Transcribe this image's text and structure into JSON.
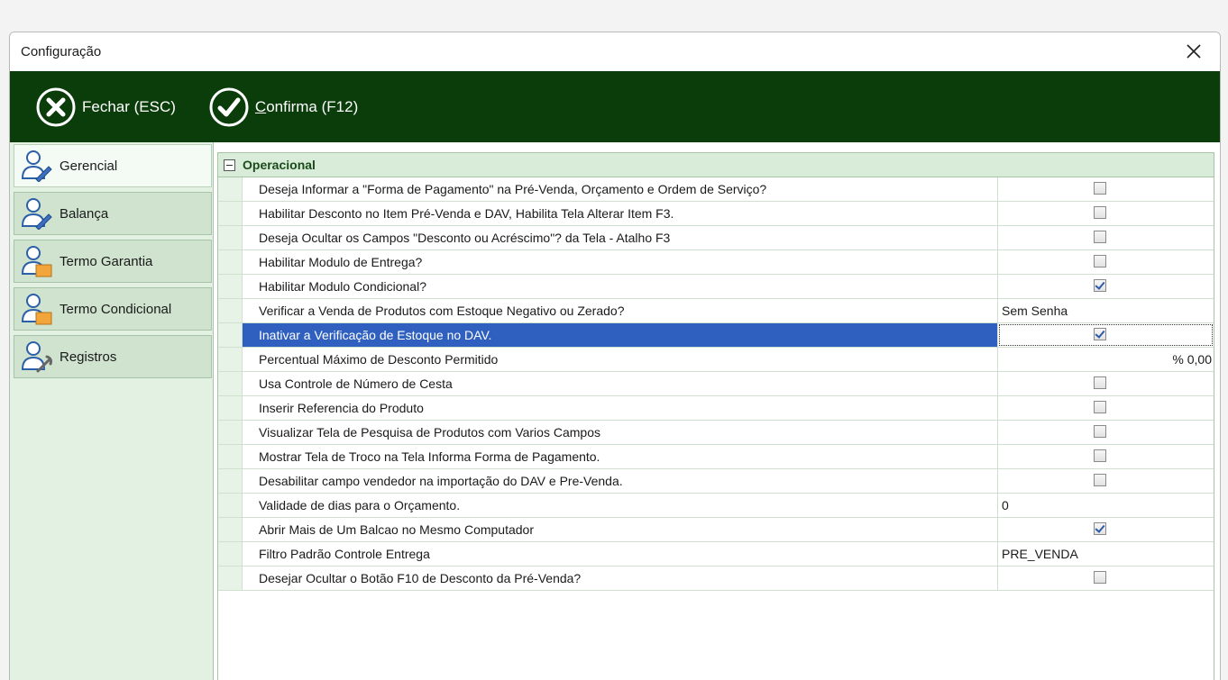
{
  "window": {
    "title": "Configuração"
  },
  "toolbar": {
    "close_label": "Fechar (ESC)",
    "confirm_letter": "C",
    "confirm_rest": "onfirma (F12)"
  },
  "sidebar": {
    "items": [
      {
        "label": "Gerencial",
        "icon": "user-pen-icon",
        "active": true
      },
      {
        "label": "Balança",
        "icon": "user-pen-icon",
        "active": false
      },
      {
        "label": "Termo Garantia",
        "icon": "user-folder-icon",
        "active": false
      },
      {
        "label": "Termo Condicional",
        "icon": "user-folder-icon",
        "active": false
      },
      {
        "label": "Registros",
        "icon": "user-wrench-icon",
        "active": false
      }
    ]
  },
  "grid": {
    "section_title": "Operacional",
    "rows": [
      {
        "label": "Deseja Informar a \"Forma de Pagamento\" na Pré-Venda, Orçamento e Ordem de Serviço?",
        "type": "checkbox",
        "checked": false
      },
      {
        "label": "Habilitar Desconto no Item Pré-Venda e DAV, Habilita Tela Alterar Item F3.",
        "type": "checkbox",
        "checked": false
      },
      {
        "label": "Deseja Ocultar os Campos \"Desconto ou Acréscimo\"? da Tela - Atalho F3",
        "type": "checkbox",
        "checked": false
      },
      {
        "label": "Habilitar Modulo de Entrega?",
        "type": "checkbox",
        "checked": false
      },
      {
        "label": "Habilitar Modulo Condicional?",
        "type": "checkbox",
        "checked": true
      },
      {
        "label": "Verificar a Venda de Produtos com Estoque Negativo ou Zerado?",
        "type": "text",
        "value": "Sem Senha"
      },
      {
        "label": "Inativar a Verificação de Estoque no DAV.",
        "type": "checkbox",
        "checked": true,
        "selected": true
      },
      {
        "label": "Percentual Máximo de Desconto Permitido",
        "type": "number",
        "value": "% 0,00"
      },
      {
        "label": "Usa Controle de Número de Cesta",
        "type": "checkbox",
        "checked": false
      },
      {
        "label": "Inserir Referencia do Produto",
        "type": "checkbox",
        "checked": false
      },
      {
        "label": "Visualizar Tela de Pesquisa de Produtos com Varios Campos",
        "type": "checkbox",
        "checked": false
      },
      {
        "label": "Mostrar Tela de Troco na Tela Informa Forma de Pagamento.",
        "type": "checkbox",
        "checked": false
      },
      {
        "label": "Desabilitar campo vendedor na importação do DAV e Pre-Venda.",
        "type": "checkbox",
        "checked": false
      },
      {
        "label": "Validade de dias para o Orçamento.",
        "type": "text",
        "value": "0"
      },
      {
        "label": "Abrir Mais de Um Balcao no Mesmo Computador",
        "type": "checkbox",
        "checked": true
      },
      {
        "label": "Filtro Padrão Controle Entrega",
        "type": "text",
        "value": "PRE_VENDA"
      },
      {
        "label": "Desejar Ocultar o Botão F10 de Desconto da Pré-Venda?",
        "type": "checkbox",
        "checked": false
      }
    ]
  },
  "colors": {
    "toolbar_bg": "#0a3d0a",
    "sidebar_bg": "#e3f1e3",
    "selection": "#2f5fbf",
    "section_bg": "#d9ecd9"
  }
}
